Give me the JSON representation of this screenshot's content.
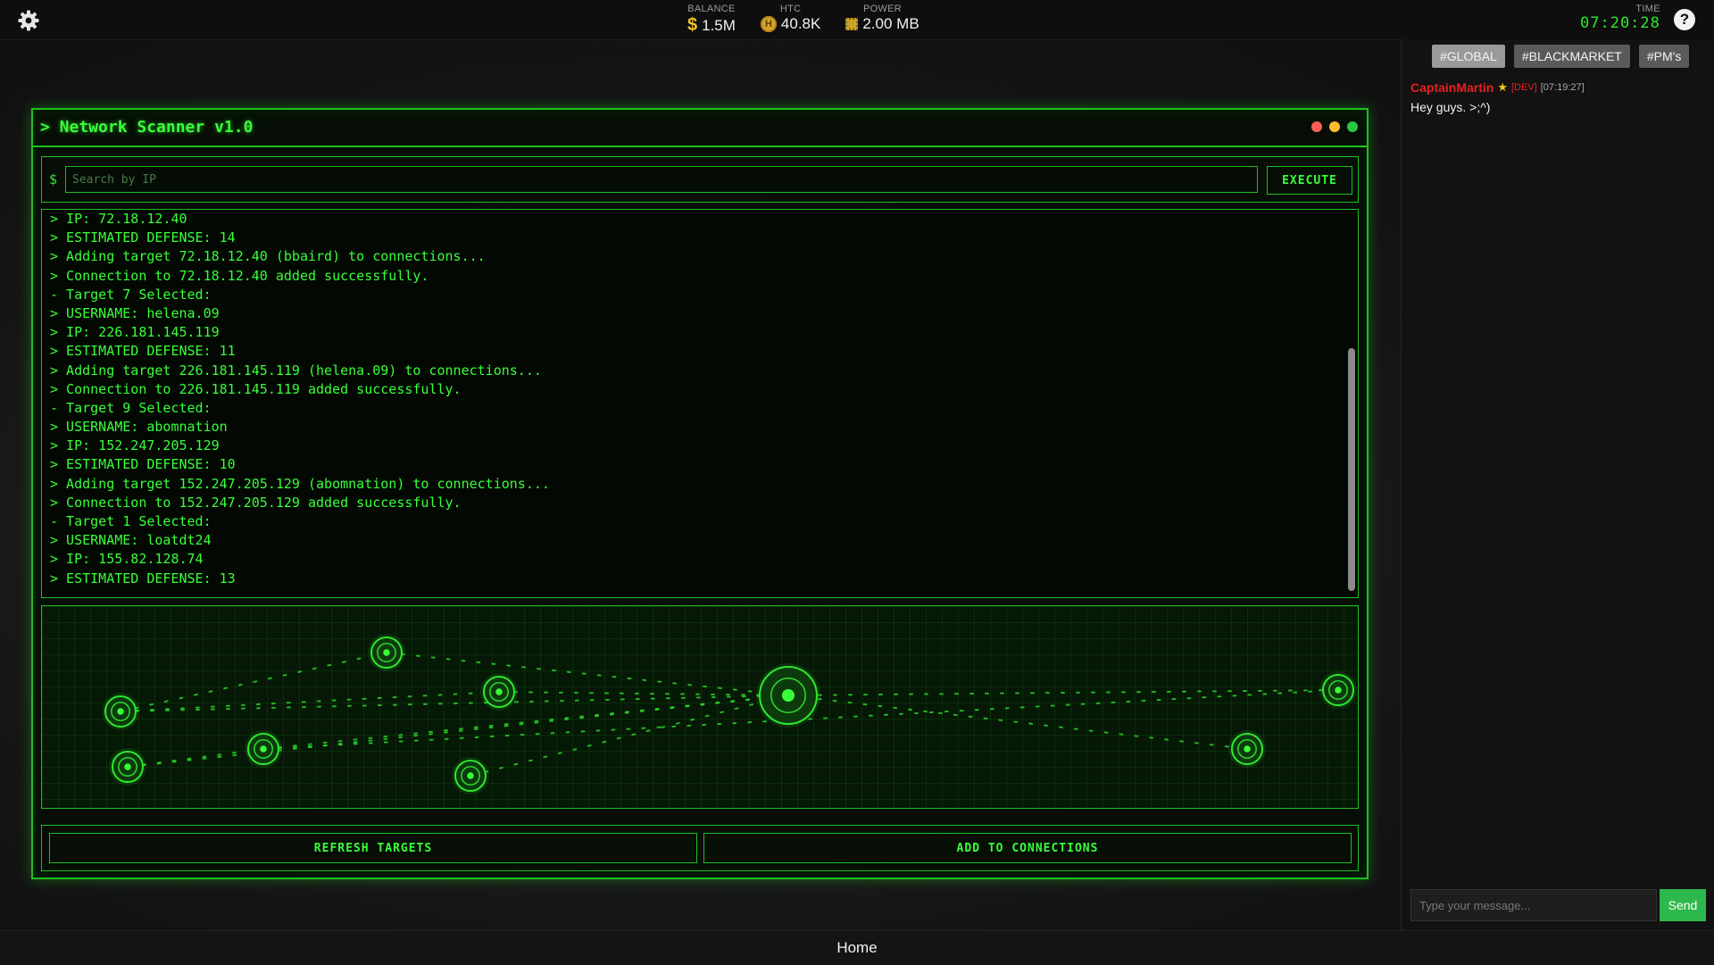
{
  "topbar": {
    "icons": {
      "settings": "gear-icon",
      "help": "question-icon"
    },
    "balance": {
      "label": "BALANCE",
      "value": "1.5M",
      "icon": "dollar-icon"
    },
    "htc": {
      "label": "HTC",
      "value": "40.8K",
      "icon": "coin-icon",
      "icon_glyph": "H"
    },
    "power": {
      "label": "POWER",
      "value": "2.00 MB",
      "icon": "chip-icon"
    },
    "time": {
      "label": "TIME",
      "value": "07:20:28"
    }
  },
  "scanner": {
    "title": "> Network Scanner v1.0",
    "window_dot_colors": [
      "#ff5f57",
      "#febc2e",
      "#28c840"
    ],
    "search": {
      "prompt": "$",
      "placeholder": "Search by IP",
      "value": ""
    },
    "execute_label": "EXECUTE",
    "log_lines": [
      "> IP: 72.18.12.40",
      "> ESTIMATED DEFENSE: 14",
      "> Adding target 72.18.12.40 (bbaird) to connections...",
      "> Connection to 72.18.12.40 added successfully.",
      "- Target 7 Selected:",
      "> USERNAME: helena.09",
      "> IP: 226.181.145.119",
      "> ESTIMATED DEFENSE: 11",
      "> Adding target 226.181.145.119 (helena.09) to connections...",
      "> Connection to 226.181.145.119 added successfully.",
      "- Target 9 Selected:",
      "> USERNAME: abomnation",
      "> IP: 152.247.205.129",
      "> ESTIMATED DEFENSE: 10",
      "> Adding target 152.247.205.129 (abomnation) to connections...",
      "> Connection to 152.247.205.129 added successfully.",
      "- Target 1 Selected:",
      "> USERNAME: loatdt24",
      "> IP: 155.82.128.74",
      "> ESTIMATED DEFENSE: 13"
    ],
    "refresh_label": "REFRESH TARGETS",
    "add_label": "ADD TO CONNECTIONS",
    "accent_color": "#1fbf1f",
    "text_color": "#39ff39"
  },
  "chat": {
    "tabs": [
      {
        "label": "#GLOBAL",
        "active": true
      },
      {
        "label": "#BLACKMARKET",
        "active": false
      },
      {
        "label": "#PM's",
        "active": false
      }
    ],
    "messages": [
      {
        "user": "CaptainMartin",
        "tag": "[DEV]",
        "time": "[07:19:27]",
        "text": "Hey guys. >;^)"
      }
    ],
    "input_placeholder": "Type your message...",
    "send_label": "Send",
    "send_color": "#2db84d"
  },
  "footer": {
    "home_label": "Home"
  }
}
